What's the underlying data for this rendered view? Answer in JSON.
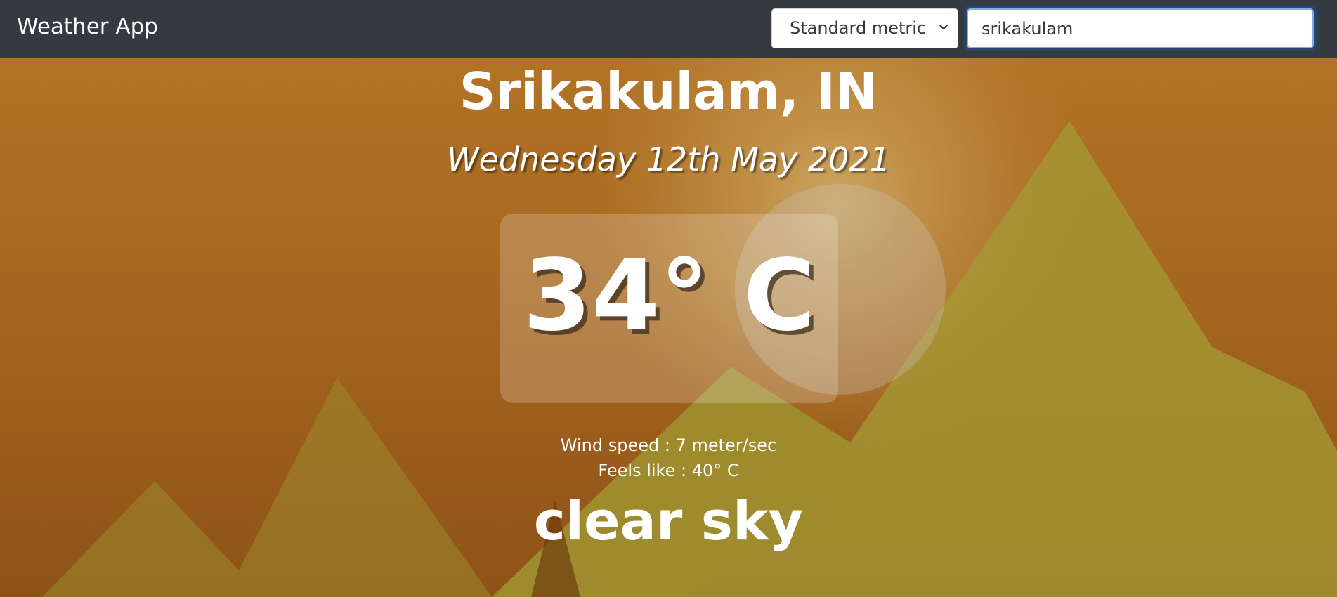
{
  "navbar": {
    "brand": "Weather App",
    "unit_select": {
      "selected": "Standard metric"
    },
    "search": {
      "value": "srikakulam"
    }
  },
  "weather": {
    "location": "Srikakulam, IN",
    "date": "Wednesday 12th May 2021",
    "temperature": "34° C",
    "wind_speed": "Wind speed : 7 meter/sec",
    "feels_like": "Feels like : 40° C",
    "description": "clear sky"
  },
  "icons": {
    "select_arrow": "chevron-down-icon"
  },
  "colors": {
    "navbar_bg": "#343a40",
    "sky_top": "#b27326",
    "sky_bottom": "#8e5218",
    "mountain": "#9a9030",
    "text": "#ffffff"
  }
}
